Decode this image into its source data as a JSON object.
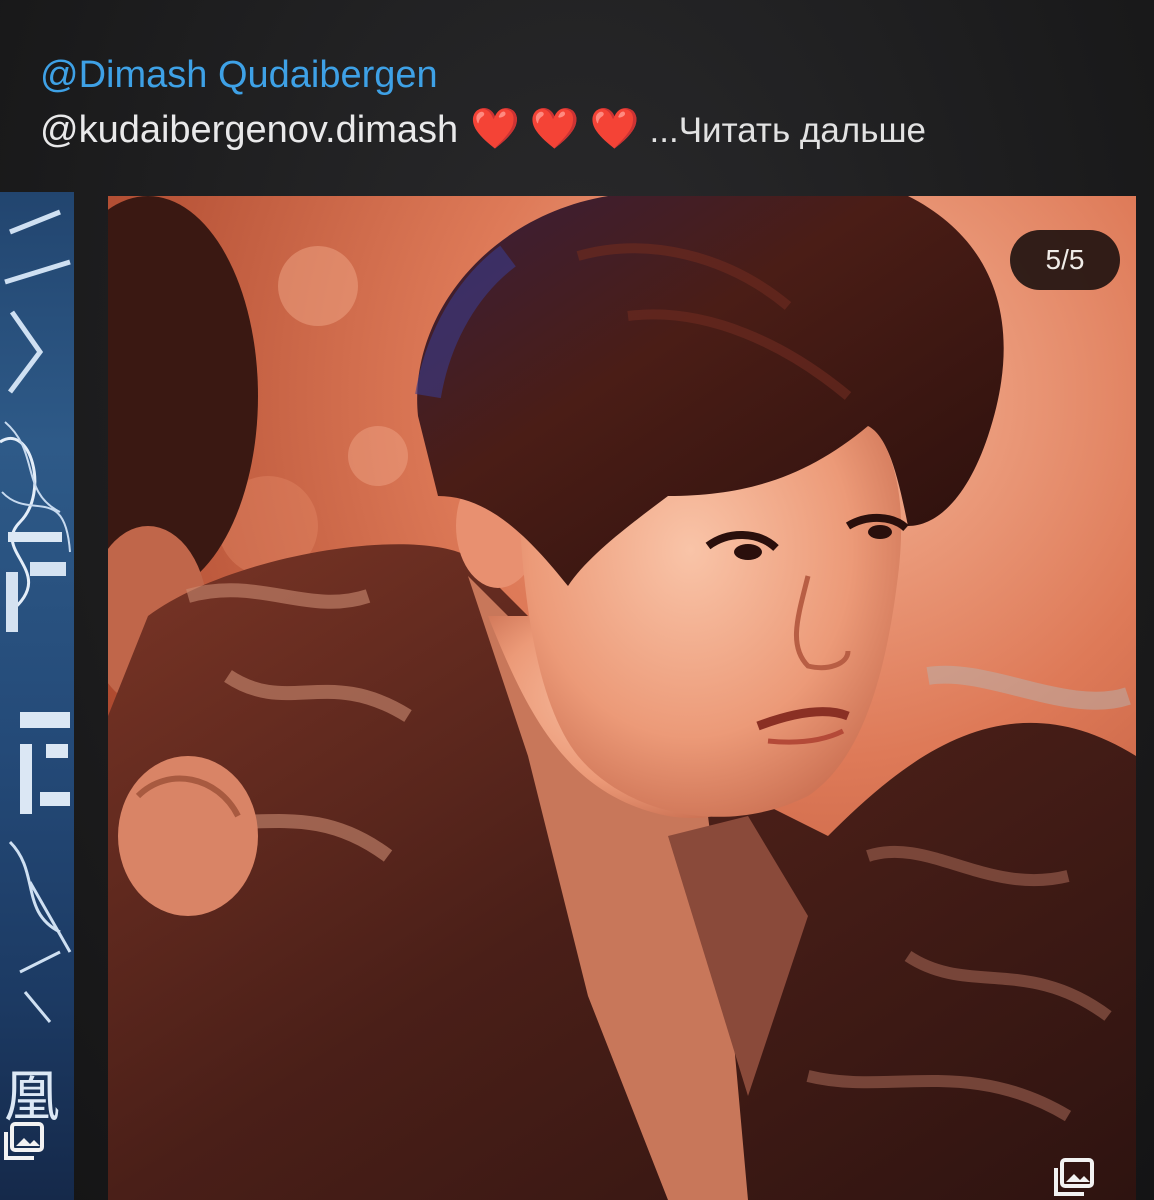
{
  "post": {
    "mention_primary": "@Dimash Qudaibergen",
    "mention_secondary": "@kudaibergenov.dimash",
    "hearts": "❤️❤️❤️",
    "read_more": "...Читать дальше",
    "image_counter": "5/5"
  },
  "left_post": {
    "poster_glyph": "凰"
  },
  "colors": {
    "mention_primary": "#3ea1e6",
    "heart": "#e02a33",
    "background": "#1c1c1e"
  },
  "icons": {
    "gallery": "multiple-images-icon"
  }
}
